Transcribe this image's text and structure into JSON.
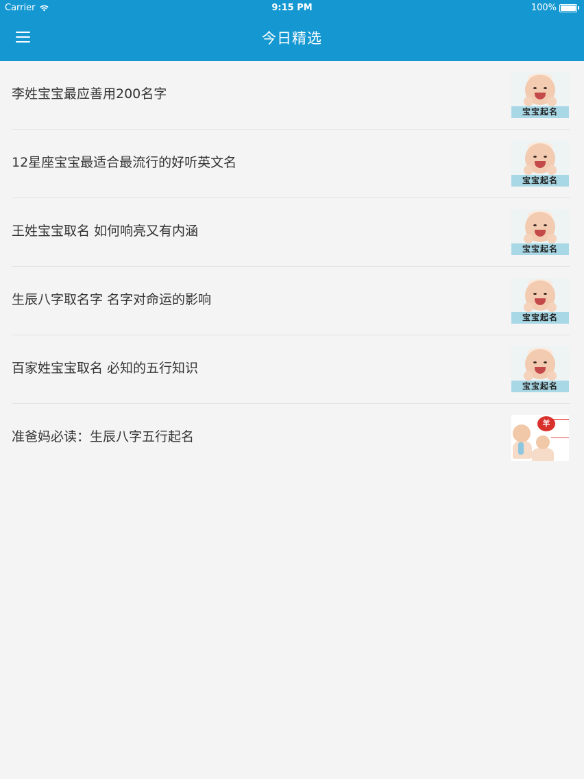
{
  "status_bar": {
    "carrier": "Carrier",
    "time": "9:15 PM",
    "battery": "100%",
    "battery_level": 1.0
  },
  "navbar": {
    "title": "今日精选",
    "menu_icon": "hamburger-menu-icon"
  },
  "colors": {
    "header_bg": "#1598d2",
    "page_bg": "#f4f4f4",
    "title_text": "#333333",
    "divider": "#e3e3e3"
  },
  "articles": [
    {
      "title": "李姓宝宝最应善用200名字",
      "thumbnail_caption": "宝宝起名"
    },
    {
      "title": "12星座宝宝最适合最流行的好听英文名",
      "thumbnail_caption": "宝宝起名"
    },
    {
      "title": "王姓宝宝取名 如何响亮又有内涵",
      "thumbnail_caption": "宝宝起名"
    },
    {
      "title": "生辰八字取名字 名字对命运的影响",
      "thumbnail_caption": "宝宝起名"
    },
    {
      "title": "百家姓宝宝取名 必知的五行知识",
      "thumbnail_caption": "宝宝起名"
    },
    {
      "title": "准爸妈必读：生辰八字五行起名",
      "thumbnail_badge": "羊"
    }
  ]
}
